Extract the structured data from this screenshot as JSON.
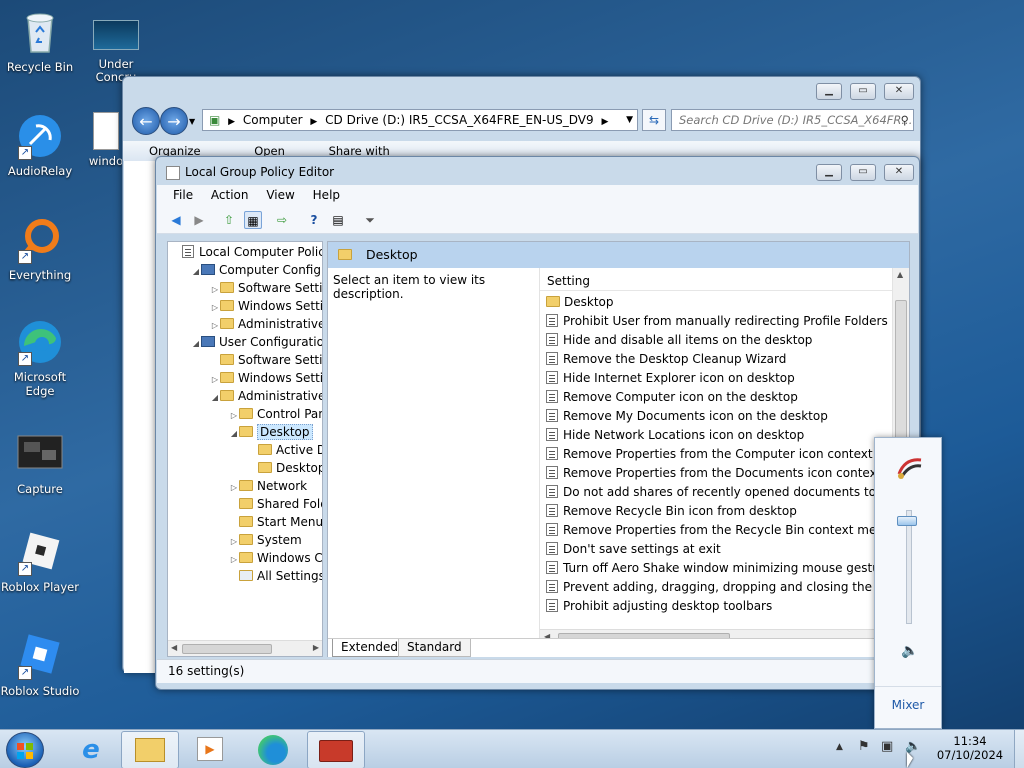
{
  "desktop": {
    "icons": [
      {
        "label": "Recycle Bin"
      },
      {
        "label": "AudioRelay"
      },
      {
        "label": "Everything"
      },
      {
        "label": "Microsoft Edge"
      },
      {
        "label": "Capture"
      },
      {
        "label": "Roblox Player"
      },
      {
        "label": "Roblox Studio"
      },
      {
        "label": "Under Concru"
      },
      {
        "label": "windo"
      }
    ]
  },
  "explorer": {
    "breadcrumb": [
      "Computer",
      "CD Drive (D:) IR5_CCSA_X64FRE_EN-US_DV9"
    ],
    "search_placeholder": "Search CD Drive (D:) IR5_CCSA_X64FR...",
    "toolbar": [
      "Organize",
      "Open",
      "Share with"
    ]
  },
  "gpedit": {
    "title": "Local Group Policy Editor",
    "menu": [
      "File",
      "Action",
      "View",
      "Help"
    ],
    "tree": [
      {
        "label": "Local Computer Policy",
        "indent": 0,
        "arrow": "",
        "type": "root"
      },
      {
        "label": "Computer Configura",
        "indent": 1,
        "arrow": "◢",
        "type": "comp"
      },
      {
        "label": "Software Settings",
        "indent": 2,
        "arrow": "▷",
        "type": "folder"
      },
      {
        "label": "Windows Setting",
        "indent": 2,
        "arrow": "▷",
        "type": "folder"
      },
      {
        "label": "Administrative Te",
        "indent": 2,
        "arrow": "▷",
        "type": "folder"
      },
      {
        "label": "User Configuration",
        "indent": 1,
        "arrow": "◢",
        "type": "user"
      },
      {
        "label": "Software Settings",
        "indent": 2,
        "arrow": "",
        "type": "folder"
      },
      {
        "label": "Windows Setting",
        "indent": 2,
        "arrow": "▷",
        "type": "folder"
      },
      {
        "label": "Administrative Te",
        "indent": 2,
        "arrow": "◢",
        "type": "folder"
      },
      {
        "label": "Control Panel",
        "indent": 3,
        "arrow": "▷",
        "type": "folder"
      },
      {
        "label": "Desktop",
        "indent": 3,
        "arrow": "◢",
        "type": "folder",
        "selected": true
      },
      {
        "label": "Active Dir",
        "indent": 4,
        "arrow": "",
        "type": "folder"
      },
      {
        "label": "Desktop",
        "indent": 4,
        "arrow": "",
        "type": "folder"
      },
      {
        "label": "Network",
        "indent": 3,
        "arrow": "▷",
        "type": "folder"
      },
      {
        "label": "Shared Folder",
        "indent": 3,
        "arrow": "",
        "type": "folder"
      },
      {
        "label": "Start Menu ar",
        "indent": 3,
        "arrow": "",
        "type": "folder"
      },
      {
        "label": "System",
        "indent": 3,
        "arrow": "▷",
        "type": "folder"
      },
      {
        "label": "Windows Cor",
        "indent": 3,
        "arrow": "▷",
        "type": "folder"
      },
      {
        "label": "All Settings",
        "indent": 3,
        "arrow": "",
        "type": "all"
      }
    ],
    "pane_title": "Desktop",
    "description": "Select an item to view its description.",
    "column_header": "Setting",
    "settings": [
      {
        "label": "Desktop",
        "type": "folder"
      },
      {
        "label": "Prohibit User from manually redirecting Profile Folders",
        "type": "policy"
      },
      {
        "label": "Hide and disable all items on the desktop",
        "type": "policy"
      },
      {
        "label": "Remove the Desktop Cleanup Wizard",
        "type": "policy"
      },
      {
        "label": "Hide Internet Explorer icon on desktop",
        "type": "policy"
      },
      {
        "label": "Remove Computer icon on the desktop",
        "type": "policy"
      },
      {
        "label": "Remove My Documents icon on the desktop",
        "type": "policy"
      },
      {
        "label": "Hide Network Locations icon on desktop",
        "type": "policy"
      },
      {
        "label": "Remove Properties from the Computer icon context menu",
        "type": "policy"
      },
      {
        "label": "Remove Properties from the Documents icon context menu",
        "type": "policy"
      },
      {
        "label": "Do not add shares of recently opened documents to Network",
        "type": "policy"
      },
      {
        "label": "Remove Recycle Bin icon from desktop",
        "type": "policy"
      },
      {
        "label": "Remove Properties from the Recycle Bin context menu",
        "type": "policy"
      },
      {
        "label": "Don't save settings at exit",
        "type": "policy"
      },
      {
        "label": "Turn off Aero Shake window minimizing mouse gesture",
        "type": "policy"
      },
      {
        "label": "Prevent adding, dragging, dropping and closing the Taskbar",
        "type": "policy"
      },
      {
        "label": "Prohibit adjusting desktop toolbars",
        "type": "policy"
      }
    ],
    "tabs": [
      "Extended",
      "Standard"
    ],
    "status": "16 setting(s)"
  },
  "volume": {
    "mixer_label": "Mixer",
    "level": 0.9
  },
  "taskbar": {
    "time": "11:34",
    "date": "07/10/2024"
  },
  "colors": {
    "selection": "#cce8ff",
    "header_blue": "#b9d3ee",
    "taskbar": "#c7daed"
  }
}
